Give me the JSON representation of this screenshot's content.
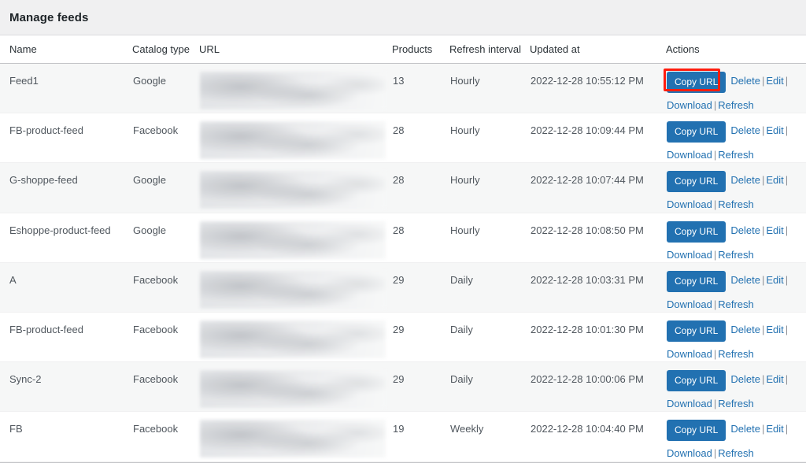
{
  "header": {
    "title": "Manage feeds"
  },
  "table": {
    "columns": [
      {
        "key": "name",
        "label": "Name"
      },
      {
        "key": "catalog",
        "label": "Catalog type"
      },
      {
        "key": "url",
        "label": "URL"
      },
      {
        "key": "products",
        "label": "Products"
      },
      {
        "key": "refresh",
        "label": "Refresh interval"
      },
      {
        "key": "updated",
        "label": "Updated at"
      },
      {
        "key": "actions",
        "label": "Actions"
      }
    ],
    "action_labels": {
      "copy_url": "Copy URL",
      "delete": "Delete",
      "edit": "Edit",
      "download": "Download",
      "refresh": "Refresh",
      "separator": "|"
    },
    "rows": [
      {
        "name": "Feed1",
        "catalog": "Google",
        "url": "",
        "products": "13",
        "refresh": "Hourly",
        "updated": "2022-12-28 10:55:12 PM",
        "highlighted": true
      },
      {
        "name": "FB-product-feed",
        "catalog": "Facebook",
        "url": "",
        "products": "28",
        "refresh": "Hourly",
        "updated": "2022-12-28 10:09:44 PM",
        "highlighted": false
      },
      {
        "name": "G-shoppe-feed",
        "catalog": "Google",
        "url": "",
        "products": "28",
        "refresh": "Hourly",
        "updated": "2022-12-28 10:07:44 PM",
        "highlighted": false
      },
      {
        "name": "Eshoppe-product-feed",
        "catalog": "Google",
        "url": "",
        "products": "28",
        "refresh": "Hourly",
        "updated": "2022-12-28 10:08:50 PM",
        "highlighted": false
      },
      {
        "name": "A",
        "catalog": "Facebook",
        "url": "",
        "products": "29",
        "refresh": "Daily",
        "updated": "2022-12-28 10:03:31 PM",
        "highlighted": false
      },
      {
        "name": "FB-product-feed",
        "catalog": "Facebook",
        "url": "",
        "products": "29",
        "refresh": "Daily",
        "updated": "2022-12-28 10:01:30 PM",
        "highlighted": false
      },
      {
        "name": "Sync-2",
        "catalog": "Facebook",
        "url": "",
        "products": "29",
        "refresh": "Daily",
        "updated": "2022-12-28 10:00:06 PM",
        "highlighted": false
      },
      {
        "name": "FB",
        "catalog": "Facebook",
        "url": "",
        "products": "19",
        "refresh": "Weekly",
        "updated": "2022-12-28 10:04:40 PM",
        "highlighted": false
      }
    ]
  },
  "colors": {
    "page_background": "#f0f0f1",
    "button_blue": "#2271b1",
    "link_blue": "#2271b1",
    "highlight_red": "#ff1d0e",
    "row_stripe": "#f6f7f7"
  }
}
